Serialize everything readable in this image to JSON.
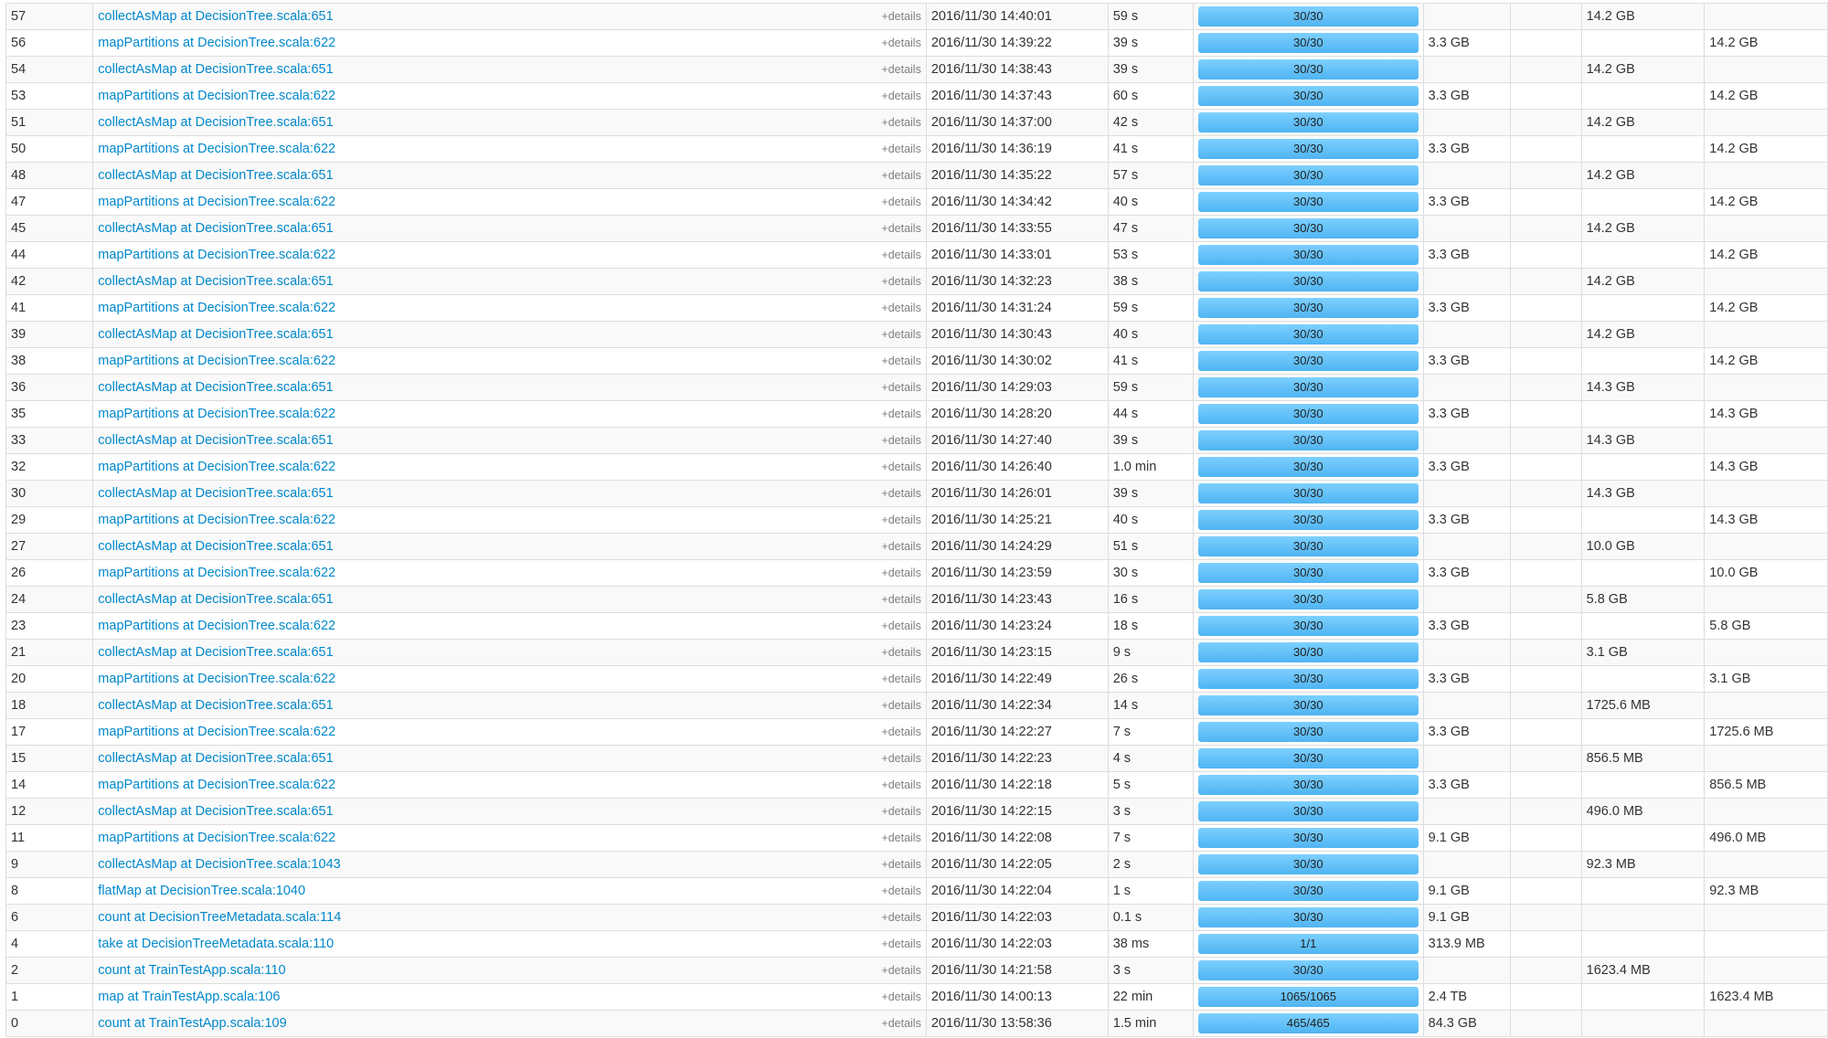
{
  "stages_table": {
    "details_label": "+details",
    "rows": [
      {
        "id": "57",
        "desc": "collectAsMap at DecisionTree.scala:651",
        "submitted": "2016/11/30 14:40:01",
        "duration": "59 s",
        "tasks": "30/30",
        "progress": 1.0,
        "input": "",
        "output": "",
        "shuffle_read": "14.2 GB",
        "shuffle_write": ""
      },
      {
        "id": "56",
        "desc": "mapPartitions at DecisionTree.scala:622",
        "submitted": "2016/11/30 14:39:22",
        "duration": "39 s",
        "tasks": "30/30",
        "progress": 1.0,
        "input": "3.3 GB",
        "output": "",
        "shuffle_read": "",
        "shuffle_write": "14.2 GB"
      },
      {
        "id": "54",
        "desc": "collectAsMap at DecisionTree.scala:651",
        "submitted": "2016/11/30 14:38:43",
        "duration": "39 s",
        "tasks": "30/30",
        "progress": 1.0,
        "input": "",
        "output": "",
        "shuffle_read": "14.2 GB",
        "shuffle_write": ""
      },
      {
        "id": "53",
        "desc": "mapPartitions at DecisionTree.scala:622",
        "submitted": "2016/11/30 14:37:43",
        "duration": "60 s",
        "tasks": "30/30",
        "progress": 1.0,
        "input": "3.3 GB",
        "output": "",
        "shuffle_read": "",
        "shuffle_write": "14.2 GB"
      },
      {
        "id": "51",
        "desc": "collectAsMap at DecisionTree.scala:651",
        "submitted": "2016/11/30 14:37:00",
        "duration": "42 s",
        "tasks": "30/30",
        "progress": 1.0,
        "input": "",
        "output": "",
        "shuffle_read": "14.2 GB",
        "shuffle_write": ""
      },
      {
        "id": "50",
        "desc": "mapPartitions at DecisionTree.scala:622",
        "submitted": "2016/11/30 14:36:19",
        "duration": "41 s",
        "tasks": "30/30",
        "progress": 1.0,
        "input": "3.3 GB",
        "output": "",
        "shuffle_read": "",
        "shuffle_write": "14.2 GB"
      },
      {
        "id": "48",
        "desc": "collectAsMap at DecisionTree.scala:651",
        "submitted": "2016/11/30 14:35:22",
        "duration": "57 s",
        "tasks": "30/30",
        "progress": 1.0,
        "input": "",
        "output": "",
        "shuffle_read": "14.2 GB",
        "shuffle_write": ""
      },
      {
        "id": "47",
        "desc": "mapPartitions at DecisionTree.scala:622",
        "submitted": "2016/11/30 14:34:42",
        "duration": "40 s",
        "tasks": "30/30",
        "progress": 1.0,
        "input": "3.3 GB",
        "output": "",
        "shuffle_read": "",
        "shuffle_write": "14.2 GB"
      },
      {
        "id": "45",
        "desc": "collectAsMap at DecisionTree.scala:651",
        "submitted": "2016/11/30 14:33:55",
        "duration": "47 s",
        "tasks": "30/30",
        "progress": 1.0,
        "input": "",
        "output": "",
        "shuffle_read": "14.2 GB",
        "shuffle_write": ""
      },
      {
        "id": "44",
        "desc": "mapPartitions at DecisionTree.scala:622",
        "submitted": "2016/11/30 14:33:01",
        "duration": "53 s",
        "tasks": "30/30",
        "progress": 1.0,
        "input": "3.3 GB",
        "output": "",
        "shuffle_read": "",
        "shuffle_write": "14.2 GB"
      },
      {
        "id": "42",
        "desc": "collectAsMap at DecisionTree.scala:651",
        "submitted": "2016/11/30 14:32:23",
        "duration": "38 s",
        "tasks": "30/30",
        "progress": 1.0,
        "input": "",
        "output": "",
        "shuffle_read": "14.2 GB",
        "shuffle_write": ""
      },
      {
        "id": "41",
        "desc": "mapPartitions at DecisionTree.scala:622",
        "submitted": "2016/11/30 14:31:24",
        "duration": "59 s",
        "tasks": "30/30",
        "progress": 1.0,
        "input": "3.3 GB",
        "output": "",
        "shuffle_read": "",
        "shuffle_write": "14.2 GB"
      },
      {
        "id": "39",
        "desc": "collectAsMap at DecisionTree.scala:651",
        "submitted": "2016/11/30 14:30:43",
        "duration": "40 s",
        "tasks": "30/30",
        "progress": 1.0,
        "input": "",
        "output": "",
        "shuffle_read": "14.2 GB",
        "shuffle_write": ""
      },
      {
        "id": "38",
        "desc": "mapPartitions at DecisionTree.scala:622",
        "submitted": "2016/11/30 14:30:02",
        "duration": "41 s",
        "tasks": "30/30",
        "progress": 1.0,
        "input": "3.3 GB",
        "output": "",
        "shuffle_read": "",
        "shuffle_write": "14.2 GB"
      },
      {
        "id": "36",
        "desc": "collectAsMap at DecisionTree.scala:651",
        "submitted": "2016/11/30 14:29:03",
        "duration": "59 s",
        "tasks": "30/30",
        "progress": 1.0,
        "input": "",
        "output": "",
        "shuffle_read": "14.3 GB",
        "shuffle_write": ""
      },
      {
        "id": "35",
        "desc": "mapPartitions at DecisionTree.scala:622",
        "submitted": "2016/11/30 14:28:20",
        "duration": "44 s",
        "tasks": "30/30",
        "progress": 1.0,
        "input": "3.3 GB",
        "output": "",
        "shuffle_read": "",
        "shuffle_write": "14.3 GB"
      },
      {
        "id": "33",
        "desc": "collectAsMap at DecisionTree.scala:651",
        "submitted": "2016/11/30 14:27:40",
        "duration": "39 s",
        "tasks": "30/30",
        "progress": 1.0,
        "input": "",
        "output": "",
        "shuffle_read": "14.3 GB",
        "shuffle_write": ""
      },
      {
        "id": "32",
        "desc": "mapPartitions at DecisionTree.scala:622",
        "submitted": "2016/11/30 14:26:40",
        "duration": "1.0 min",
        "tasks": "30/30",
        "progress": 1.0,
        "input": "3.3 GB",
        "output": "",
        "shuffle_read": "",
        "shuffle_write": "14.3 GB"
      },
      {
        "id": "30",
        "desc": "collectAsMap at DecisionTree.scala:651",
        "submitted": "2016/11/30 14:26:01",
        "duration": "39 s",
        "tasks": "30/30",
        "progress": 1.0,
        "input": "",
        "output": "",
        "shuffle_read": "14.3 GB",
        "shuffle_write": ""
      },
      {
        "id": "29",
        "desc": "mapPartitions at DecisionTree.scala:622",
        "submitted": "2016/11/30 14:25:21",
        "duration": "40 s",
        "tasks": "30/30",
        "progress": 1.0,
        "input": "3.3 GB",
        "output": "",
        "shuffle_read": "",
        "shuffle_write": "14.3 GB"
      },
      {
        "id": "27",
        "desc": "collectAsMap at DecisionTree.scala:651",
        "submitted": "2016/11/30 14:24:29",
        "duration": "51 s",
        "tasks": "30/30",
        "progress": 1.0,
        "input": "",
        "output": "",
        "shuffle_read": "10.0 GB",
        "shuffle_write": ""
      },
      {
        "id": "26",
        "desc": "mapPartitions at DecisionTree.scala:622",
        "submitted": "2016/11/30 14:23:59",
        "duration": "30 s",
        "tasks": "30/30",
        "progress": 1.0,
        "input": "3.3 GB",
        "output": "",
        "shuffle_read": "",
        "shuffle_write": "10.0 GB"
      },
      {
        "id": "24",
        "desc": "collectAsMap at DecisionTree.scala:651",
        "submitted": "2016/11/30 14:23:43",
        "duration": "16 s",
        "tasks": "30/30",
        "progress": 1.0,
        "input": "",
        "output": "",
        "shuffle_read": "5.8 GB",
        "shuffle_write": ""
      },
      {
        "id": "23",
        "desc": "mapPartitions at DecisionTree.scala:622",
        "submitted": "2016/11/30 14:23:24",
        "duration": "18 s",
        "tasks": "30/30",
        "progress": 1.0,
        "input": "3.3 GB",
        "output": "",
        "shuffle_read": "",
        "shuffle_write": "5.8 GB"
      },
      {
        "id": "21",
        "desc": "collectAsMap at DecisionTree.scala:651",
        "submitted": "2016/11/30 14:23:15",
        "duration": "9 s",
        "tasks": "30/30",
        "progress": 1.0,
        "input": "",
        "output": "",
        "shuffle_read": "3.1 GB",
        "shuffle_write": ""
      },
      {
        "id": "20",
        "desc": "mapPartitions at DecisionTree.scala:622",
        "submitted": "2016/11/30 14:22:49",
        "duration": "26 s",
        "tasks": "30/30",
        "progress": 1.0,
        "input": "3.3 GB",
        "output": "",
        "shuffle_read": "",
        "shuffle_write": "3.1 GB"
      },
      {
        "id": "18",
        "desc": "collectAsMap at DecisionTree.scala:651",
        "submitted": "2016/11/30 14:22:34",
        "duration": "14 s",
        "tasks": "30/30",
        "progress": 1.0,
        "input": "",
        "output": "",
        "shuffle_read": "1725.6 MB",
        "shuffle_write": ""
      },
      {
        "id": "17",
        "desc": "mapPartitions at DecisionTree.scala:622",
        "submitted": "2016/11/30 14:22:27",
        "duration": "7 s",
        "tasks": "30/30",
        "progress": 1.0,
        "input": "3.3 GB",
        "output": "",
        "shuffle_read": "",
        "shuffle_write": "1725.6 MB"
      },
      {
        "id": "15",
        "desc": "collectAsMap at DecisionTree.scala:651",
        "submitted": "2016/11/30 14:22:23",
        "duration": "4 s",
        "tasks": "30/30",
        "progress": 1.0,
        "input": "",
        "output": "",
        "shuffle_read": "856.5 MB",
        "shuffle_write": ""
      },
      {
        "id": "14",
        "desc": "mapPartitions at DecisionTree.scala:622",
        "submitted": "2016/11/30 14:22:18",
        "duration": "5 s",
        "tasks": "30/30",
        "progress": 1.0,
        "input": "3.3 GB",
        "output": "",
        "shuffle_read": "",
        "shuffle_write": "856.5 MB"
      },
      {
        "id": "12",
        "desc": "collectAsMap at DecisionTree.scala:651",
        "submitted": "2016/11/30 14:22:15",
        "duration": "3 s",
        "tasks": "30/30",
        "progress": 1.0,
        "input": "",
        "output": "",
        "shuffle_read": "496.0 MB",
        "shuffle_write": ""
      },
      {
        "id": "11",
        "desc": "mapPartitions at DecisionTree.scala:622",
        "submitted": "2016/11/30 14:22:08",
        "duration": "7 s",
        "tasks": "30/30",
        "progress": 1.0,
        "input": "9.1 GB",
        "output": "",
        "shuffle_read": "",
        "shuffle_write": "496.0 MB"
      },
      {
        "id": "9",
        "desc": "collectAsMap at DecisionTree.scala:1043",
        "submitted": "2016/11/30 14:22:05",
        "duration": "2 s",
        "tasks": "30/30",
        "progress": 1.0,
        "input": "",
        "output": "",
        "shuffle_read": "92.3 MB",
        "shuffle_write": ""
      },
      {
        "id": "8",
        "desc": "flatMap at DecisionTree.scala:1040",
        "submitted": "2016/11/30 14:22:04",
        "duration": "1 s",
        "tasks": "30/30",
        "progress": 1.0,
        "input": "9.1 GB",
        "output": "",
        "shuffle_read": "",
        "shuffle_write": "92.3 MB"
      },
      {
        "id": "6",
        "desc": "count at DecisionTreeMetadata.scala:114",
        "submitted": "2016/11/30 14:22:03",
        "duration": "0.1 s",
        "tasks": "30/30",
        "progress": 1.0,
        "input": "9.1 GB",
        "output": "",
        "shuffle_read": "",
        "shuffle_write": ""
      },
      {
        "id": "4",
        "desc": "take at DecisionTreeMetadata.scala:110",
        "submitted": "2016/11/30 14:22:03",
        "duration": "38 ms",
        "tasks": "1/1",
        "progress": 1.0,
        "input": "313.9 MB",
        "output": "",
        "shuffle_read": "",
        "shuffle_write": ""
      },
      {
        "id": "2",
        "desc": "count at TrainTestApp.scala:110",
        "submitted": "2016/11/30 14:21:58",
        "duration": "3 s",
        "tasks": "30/30",
        "progress": 1.0,
        "input": "",
        "output": "",
        "shuffle_read": "1623.4 MB",
        "shuffle_write": ""
      },
      {
        "id": "1",
        "desc": "map at TrainTestApp.scala:106",
        "submitted": "2016/11/30 14:00:13",
        "duration": "22 min",
        "tasks": "1065/1065",
        "progress": 1.0,
        "input": "2.4 TB",
        "output": "",
        "shuffle_read": "",
        "shuffle_write": "1623.4 MB"
      },
      {
        "id": "0",
        "desc": "count at TrainTestApp.scala:109",
        "submitted": "2016/11/30 13:58:36",
        "duration": "1.5 min",
        "tasks": "465/465",
        "progress": 1.0,
        "input": "84.3 GB",
        "output": "",
        "shuffle_read": "",
        "shuffle_write": ""
      }
    ]
  },
  "colors": {
    "link": "#0088cc",
    "progress_fill": "#4fb4f2",
    "row_stripe": "#f9f9f9",
    "border": "#dddddd"
  }
}
